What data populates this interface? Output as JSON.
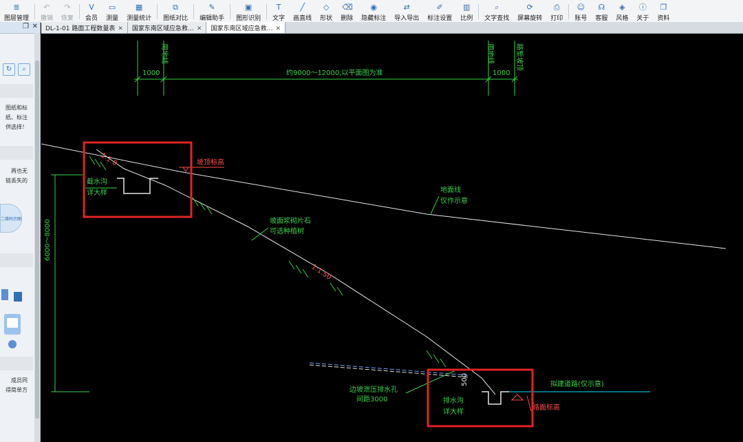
{
  "toolbar": {
    "items": [
      {
        "label": "图层管理",
        "icon": "layers-icon",
        "enabled": true
      },
      {
        "label": "撤销",
        "icon": "undo-icon",
        "enabled": false
      },
      {
        "label": "恢复",
        "icon": "redo-icon",
        "enabled": false
      },
      {
        "label": "会员",
        "icon": "vip-icon",
        "enabled": true
      },
      {
        "label": "测量",
        "icon": "ruler-icon",
        "enabled": true
      },
      {
        "label": "测量统计",
        "icon": "stats-icon",
        "enabled": true
      },
      {
        "label": "图纸对比",
        "icon": "compare-icon",
        "enabled": true
      },
      {
        "label": "编辑助手",
        "icon": "edit-assist-icon",
        "enabled": true
      },
      {
        "label": "图形识别",
        "icon": "shape-recognize-icon",
        "enabled": true
      },
      {
        "label": "文字",
        "icon": "text-icon",
        "enabled": true
      },
      {
        "label": "画直线",
        "icon": "line-icon",
        "enabled": true
      },
      {
        "label": "形状",
        "icon": "shape-icon",
        "enabled": true
      },
      {
        "label": "删除",
        "icon": "eraser-icon",
        "enabled": true
      },
      {
        "label": "隐藏标注",
        "icon": "eye-icon",
        "enabled": true
      },
      {
        "label": "导入导出",
        "icon": "import-export-icon",
        "enabled": true
      },
      {
        "label": "标注设置",
        "icon": "annotation-settings-icon",
        "enabled": true
      },
      {
        "label": "比例",
        "icon": "scale-icon",
        "enabled": true
      },
      {
        "label": "文字查找",
        "icon": "text-search-icon",
        "enabled": true
      },
      {
        "label": "屏幕旋转",
        "icon": "rotate-screen-icon",
        "enabled": true
      },
      {
        "label": "打印",
        "icon": "printer-icon",
        "enabled": true
      },
      {
        "label": "账号",
        "icon": "user-icon",
        "enabled": true
      },
      {
        "label": "客服",
        "icon": "headset-icon",
        "enabled": true
      },
      {
        "label": "风格",
        "icon": "style-icon",
        "enabled": true
      },
      {
        "label": "关于",
        "icon": "info-icon",
        "enabled": true
      },
      {
        "label": "资料",
        "icon": "docs-icon",
        "enabled": true
      }
    ]
  },
  "sidebar": {
    "texts": [
      "图纸和标",
      "纸、标注",
      "供选择！",
      "再也无",
      "链丢失的",
      "成员同",
      "得简单方"
    ],
    "badge_text": "二维码示图"
  },
  "tabs": [
    {
      "label": "DL-1-01 路面工程数量表",
      "active": false
    },
    {
      "label": "国家东南区域应急救…",
      "active": false
    },
    {
      "label": "国家东南区域应急救…",
      "active": true
    }
  ],
  "drawing": {
    "dim_left": "1000",
    "dim_middle": "约9000～12000,以平面图为准",
    "dim_right": "1000",
    "label_line_left": "用地线",
    "label_line_right1": "用地线",
    "label_line_right2": "路堑坡顶",
    "slope_top": "1:1.0",
    "ditch_top": "截水沟",
    "ditch_top_ref": "详大样",
    "top_elev": "坡顶标高",
    "ground_line": "地面线",
    "ground_line2": "仅作示意",
    "slope_protect": "坡面浆砌片石",
    "slope_protect2": "可选种植树",
    "slope_mid": "1:1.50",
    "height_dim": "6000～8000",
    "drain_hole": "边坡泄压排水孔",
    "drain_spacing": "间距3000",
    "ditch_bottom": "排水沟",
    "ditch_bottom_ref": "详大样",
    "dim_500": "500",
    "road_label": "拟建道路(仅示意)",
    "road_elev": "路面标高"
  },
  "colors": {
    "cad_green": "#39d24a",
    "cad_white": "#e6e6e6",
    "highlight_red": "#e02424",
    "cyan": "#00e5ff"
  }
}
